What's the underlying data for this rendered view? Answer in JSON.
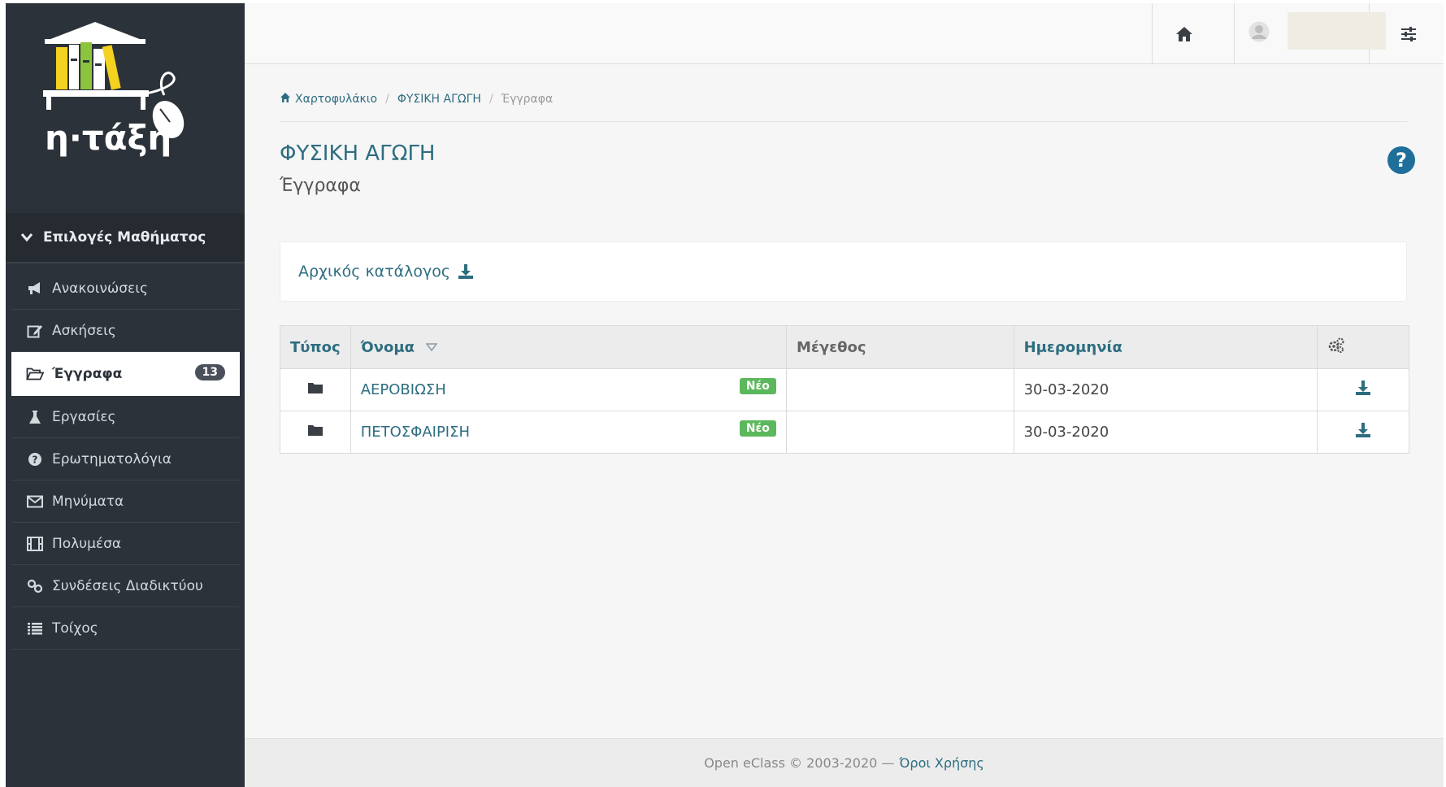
{
  "logo": {
    "text": "η·τάξη",
    "icon": "bookshelf-mouse-logo"
  },
  "sidebar": {
    "section_label": "Επιλογές Μαθήματος",
    "items": [
      {
        "label": "Ανακοινώσεις",
        "icon": "bullhorn-icon"
      },
      {
        "label": "Ασκήσεις",
        "icon": "edit-icon"
      },
      {
        "label": "Έγγραφα",
        "icon": "folder-open-icon",
        "active": true,
        "badge": "13"
      },
      {
        "label": "Εργασίες",
        "icon": "flask-icon"
      },
      {
        "label": "Ερωτηματολόγια",
        "icon": "question-circle-icon"
      },
      {
        "label": "Μηνύματα",
        "icon": "envelope-icon"
      },
      {
        "label": "Πολυμέσα",
        "icon": "film-icon"
      },
      {
        "label": "Συνδέσεις Διαδικτύου",
        "icon": "link-icon"
      },
      {
        "label": "Τοίχος",
        "icon": "list-icon"
      }
    ]
  },
  "topbar": {
    "home_icon": "home-icon",
    "user_icon": "user-icon",
    "settings_icon": "sliders-icon"
  },
  "breadcrumb": {
    "items": [
      "Χαρτοφυλάκιο",
      "ΦΥΣΙΚΗ ΑΓΩΓΗ",
      "Έγγραφα"
    ]
  },
  "page": {
    "title": "ΦΥΣΙΚΗ ΑΓΩΓΗ",
    "subtitle": "Έγγραφα"
  },
  "root_dir": {
    "label": "Αρχικός κατάλογος"
  },
  "table": {
    "headers": {
      "type": "Τύπος",
      "name": "Όνομα",
      "size": "Μέγεθος",
      "date": "Ημερομηνία"
    },
    "rows": [
      {
        "name": "ΑΕΡΟΒΙΩΣΗ",
        "badge": "Νέο",
        "size": "",
        "date": "30-03-2020"
      },
      {
        "name": "ΠΕΤΟΣΦΑΙΡΙΣΗ",
        "badge": "Νέο",
        "size": "",
        "date": "30-03-2020"
      }
    ]
  },
  "footer": {
    "copyright": "Open eClass © 2003-2020 —",
    "terms": "Όροι Χρήσης"
  },
  "colors": {
    "sidebar_bg": "#2c323a",
    "accent": "#2e6d80",
    "new_badge": "#5cb85c"
  }
}
